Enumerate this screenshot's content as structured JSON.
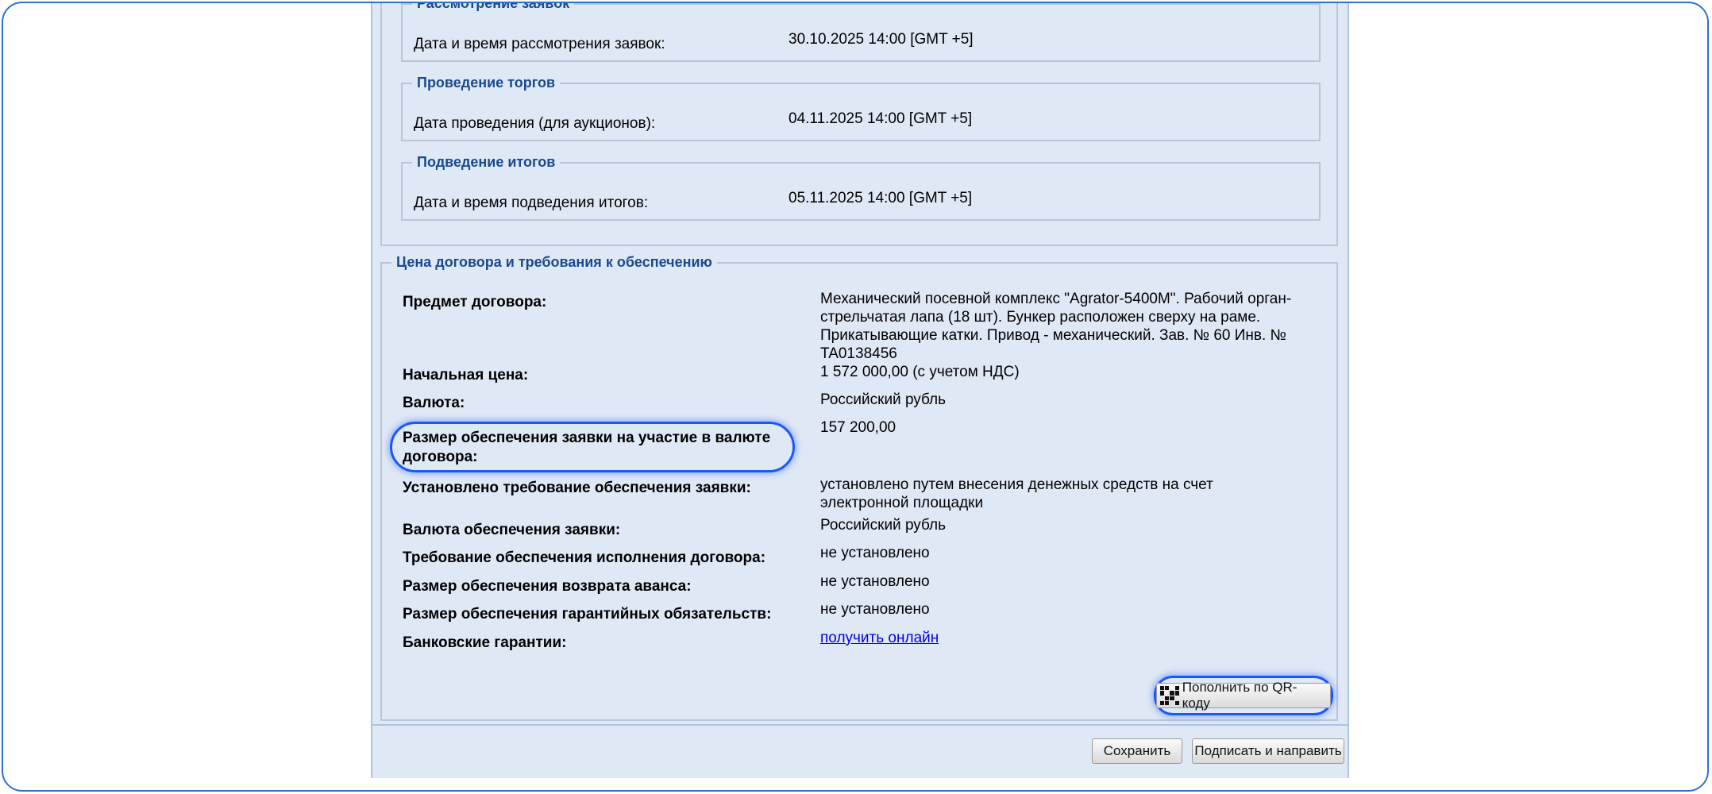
{
  "schedule": {
    "review": {
      "legend": "Рассмотрение заявок",
      "label": "Дата и время рассмотрения заявок:",
      "value": "30.10.2025 14:00 [GMT +5]"
    },
    "auction": {
      "legend": "Проведение торгов",
      "label": "Дата проведения (для аукционов):",
      "value": "04.11.2025 14:00 [GMT +5]"
    },
    "results": {
      "legend": "Подведение итогов",
      "label": "Дата и время подведения итогов:",
      "value": "05.11.2025 14:00 [GMT +5]"
    }
  },
  "price": {
    "legend": "Цена договора и требования к обеспечению",
    "rows": [
      {
        "label": "Предмет договора:",
        "value": "Механический посевной комплекс \"Agrator-5400M\". Рабочий орган- стрельчатая лапа (18 шт). Бункер расположен сверху на раме. Прикатывающие катки. Привод - механический. Зав. № 60 Инв. № TA0138456"
      },
      {
        "label": "Начальная цена:",
        "value": "1 572 000,00 (с учетом НДС)"
      },
      {
        "label": "Валюта:",
        "value": "Российский рубль"
      },
      {
        "label": "Размер обеспечения заявки на участие в валюте договора:",
        "value": "157 200,00"
      },
      {
        "label": "Установлено требование обеспечения заявки:",
        "value": "установлено путем внесения денежных средств на счет электронной площадки"
      },
      {
        "label": "Валюта обеспечения заявки:",
        "value": "Российский рубль"
      },
      {
        "label": "Требование обеспечения исполнения договора:",
        "value": "не установлено"
      },
      {
        "label": "Размер обеспечения возврата аванса:",
        "value": "не установлено"
      },
      {
        "label": "Размер обеспечения гарантийных обязательств:",
        "value": "не установлено"
      },
      {
        "label": "Банковские гарантии:",
        "value": "получить онлайн"
      }
    ],
    "qr_button": "Пополнить по QR-коду"
  },
  "footer": {
    "save_label": "Сохранить",
    "sign_label": "Подписать и направить"
  },
  "colors": {
    "accent": "#1957ff",
    "legend": "#1a4a8c",
    "panel_bg": "#dfe8f5"
  }
}
